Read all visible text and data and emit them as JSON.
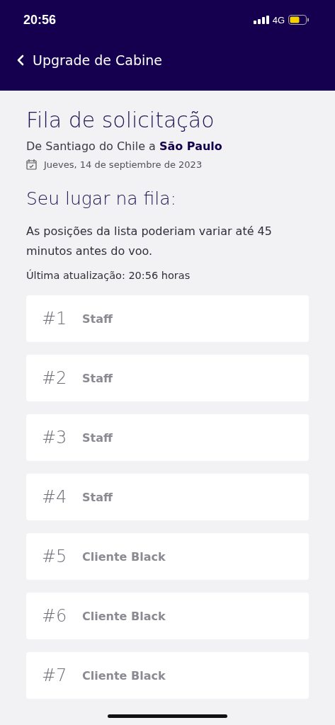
{
  "status_bar": {
    "time": "20:56",
    "network": "4G"
  },
  "nav": {
    "title": "Upgrade de Cabine"
  },
  "title": "Fila de solicitação",
  "route": "De Santiago do Chile a **São Paulo**",
  "date": "Jueves, 14 de septiembre de 2023",
  "queue_heading": "Seu lugar na fila:",
  "note": "As posições da lista poderiam variar até 45 minutos antes do voo.",
  "updated": "Última atualização: 20:56 horas",
  "queue": [
    {
      "position": "#1",
      "label": "Staff"
    },
    {
      "position": "#2",
      "label": "Staff"
    },
    {
      "position": "#3",
      "label": "Staff"
    },
    {
      "position": "#4",
      "label": "Staff"
    },
    {
      "position": "#5",
      "label": "Cliente Black"
    },
    {
      "position": "#6",
      "label": "Cliente Black"
    },
    {
      "position": "#7",
      "label": "Cliente Black"
    }
  ]
}
